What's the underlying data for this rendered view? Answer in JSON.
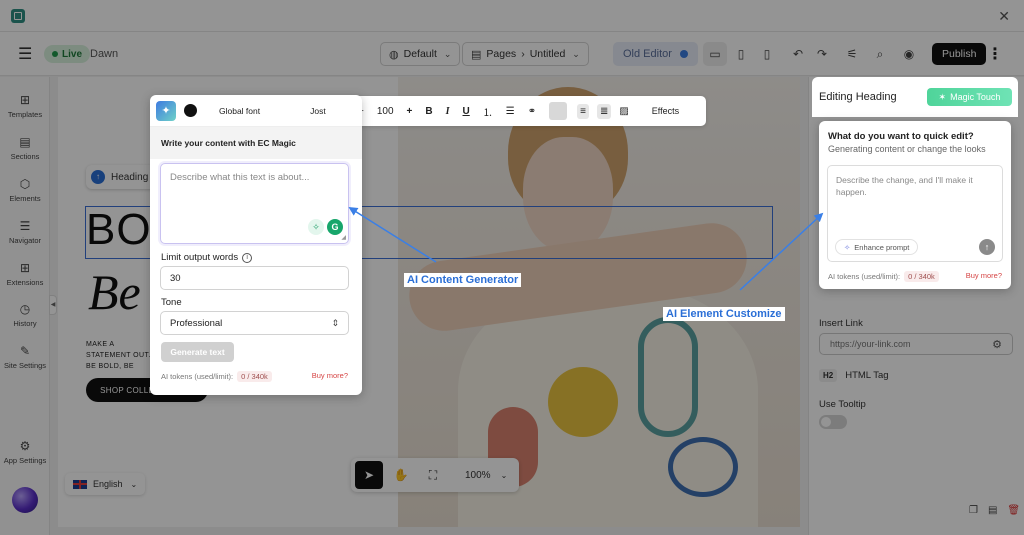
{
  "toolbar": {
    "live": "Live",
    "theme": "Dawn",
    "device": "Default",
    "pages": "Pages",
    "page_name": "Untitled",
    "old_editor": "Old Editor",
    "publish": "Publish"
  },
  "sidebar": {
    "items": [
      {
        "label": "Templates",
        "icon": "layout-icon"
      },
      {
        "label": "Sections",
        "icon": "sections-icon"
      },
      {
        "label": "Elements",
        "icon": "cube-icon"
      },
      {
        "label": "Navigator",
        "icon": "list-icon"
      },
      {
        "label": "Extensions",
        "icon": "grid-plus-icon"
      },
      {
        "label": "History",
        "icon": "clock-icon"
      },
      {
        "label": "Site Settings",
        "icon": "brush-icon"
      },
      {
        "label": "App Settings",
        "icon": "gear-icon"
      }
    ]
  },
  "format_bar": {
    "font_size": "100",
    "effects": "Effects"
  },
  "ai_panel": {
    "font_label": "Global font",
    "font_name": "Jost",
    "header": "Write your content with EC Magic",
    "placeholder": "Describe what this text is about...",
    "limit_label": "Limit output words",
    "limit_value": "30",
    "tone_label": "Tone",
    "tone_value": "Professional",
    "generate": "Generate text",
    "tokens_label": "AI tokens (used/limit):",
    "tokens_value": "0 / 340k",
    "buy_more": "Buy more?"
  },
  "canvas": {
    "heading_chip": "Heading",
    "big_line1": "BO",
    "big_line2": "Be",
    "make_text": "MAKE A STATEMENT OUT. BE BOLD, BE",
    "shop_button": "SHOP COLLECTION",
    "language": "English",
    "zoom": "100%"
  },
  "right_panel": {
    "title": "Editing Heading",
    "magic_touch": "Magic Touch",
    "insert_link_label": "Insert Link",
    "link_placeholder": "https://your-link.com",
    "html_tag_badge": "H2",
    "html_tag_label": "HTML Tag",
    "tooltip_label": "Use Tooltip"
  },
  "quick_edit": {
    "title": "What do you want to quick edit?",
    "subtitle": "Generating content or change the looks",
    "placeholder": "Describe the change, and I'll make it happen.",
    "enhance": "Enhance prompt",
    "tokens_label": "AI tokens (used/limit):",
    "tokens_value": "0 / 340k",
    "buy_more": "Buy more?"
  },
  "callouts": {
    "content_generator": "AI Content Generator",
    "element_customize": "AI Element Customize"
  },
  "colors": {
    "accent_blue": "#2b6fd6",
    "magic_green": "#4fd49a",
    "publish_black": "#111111"
  }
}
